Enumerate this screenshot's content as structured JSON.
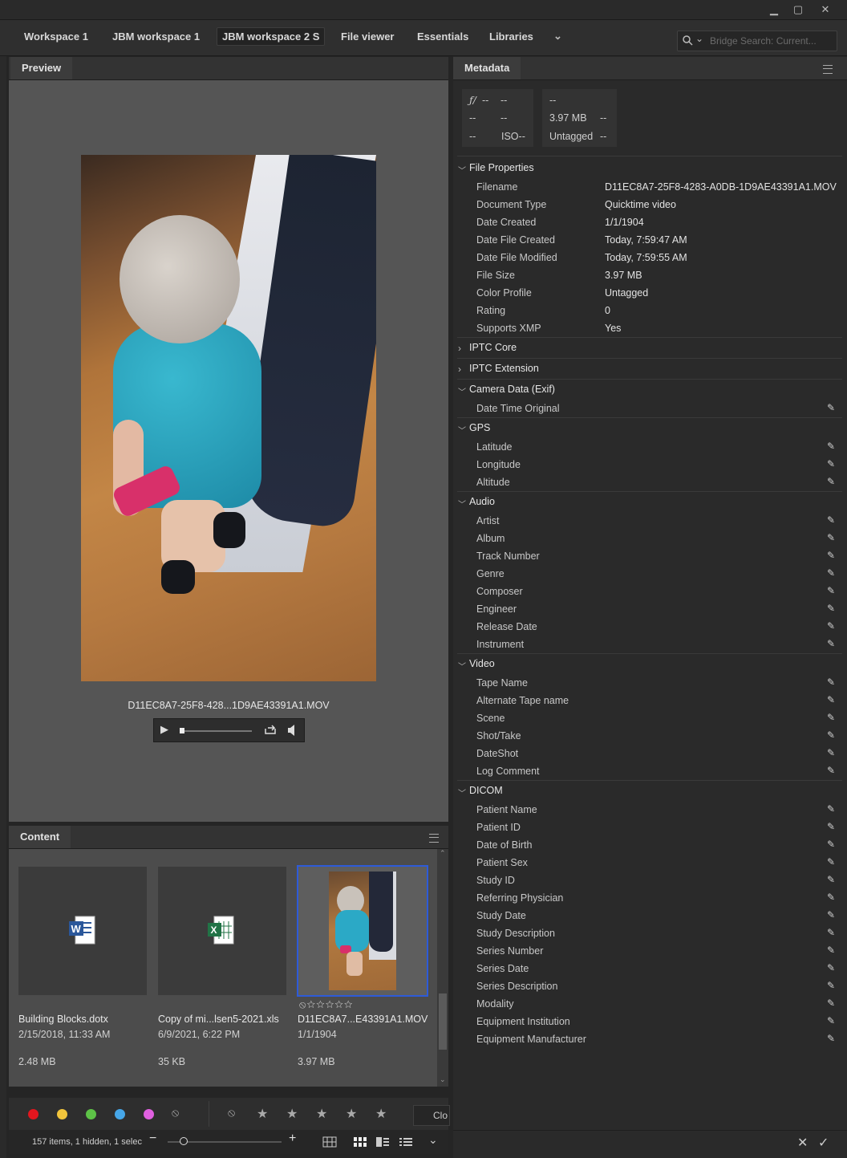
{
  "workspace": {
    "tabs": [
      "Workspace 1",
      "JBM workspace 1",
      "JBM workspace 2 S",
      "File viewer",
      "Essentials",
      "Libraries"
    ],
    "search_placeholder": "Bridge Search: Current..."
  },
  "preview": {
    "panel_title": "Preview",
    "filename": "D11EC8A7-25F8-428...1D9AE43391A1.MOV"
  },
  "content": {
    "panel_title": "Content",
    "items": [
      {
        "name": "Building Blocks.dotx",
        "date": "2/15/2018, 11:33 AM",
        "size": "2.48 MB",
        "icon": "word-document-icon"
      },
      {
        "name": "Copy of mi...lsen5-2021.xls",
        "date": "6/9/2021, 6:22 PM",
        "size": "35 KB",
        "icon": "excel-spreadsheet-icon"
      },
      {
        "name": "D11EC8A7...E43391A1.MOV",
        "date": "1/1/1904",
        "size": "3.97 MB",
        "icon": "video-thumbnail"
      }
    ],
    "label_colors": [
      "#e3161e",
      "#f2c53c",
      "#5dc247",
      "#46a6e8",
      "#e060e0"
    ],
    "status": "157 items, 1 hidden, 1 selec",
    "close_label": "Clo"
  },
  "metadata": {
    "panel_title": "Metadata",
    "camera_box": {
      "fstop": "--",
      "shutter": "--",
      "r2a": "--",
      "r2b": "--",
      "r3a": "--",
      "iso": "ISO--"
    },
    "file_box": {
      "line1": "--",
      "size": "3.97 MB",
      "size_extra": "--",
      "color": "Untagged",
      "color_extra": "--"
    },
    "file_properties": {
      "title": "File Properties",
      "rows": [
        {
          "label": "Filename",
          "value": "D11EC8A7-25F8-4283-A0DB-1D9AE43391A1.MOV"
        },
        {
          "label": "Document Type",
          "value": "Quicktime video"
        },
        {
          "label": "Date Created",
          "value": "1/1/1904"
        },
        {
          "label": "Date File Created",
          "value": "Today, 7:59:47 AM"
        },
        {
          "label": "Date File Modified",
          "value": "Today, 7:59:55 AM"
        },
        {
          "label": "File Size",
          "value": "3.97 MB"
        },
        {
          "label": "Color Profile",
          "value": "Untagged"
        },
        {
          "label": "Rating",
          "value": "0"
        },
        {
          "label": "Supports XMP",
          "value": "Yes"
        }
      ]
    },
    "iptc_core": "IPTC Core",
    "iptc_extension": "IPTC Extension",
    "camera": {
      "title": "Camera Data (Exif)",
      "rows": [
        "Date Time Original"
      ]
    },
    "gps": {
      "title": "GPS",
      "rows": [
        "Latitude",
        "Longitude",
        "Altitude"
      ]
    },
    "audio": {
      "title": "Audio",
      "rows": [
        "Artist",
        "Album",
        "Track Number",
        "Genre",
        "Composer",
        "Engineer",
        "Release Date",
        "Instrument"
      ]
    },
    "video": {
      "title": "Video",
      "rows": [
        "Tape Name",
        "Alternate Tape name",
        "Scene",
        "Shot/Take",
        "DateShot",
        "Log Comment"
      ]
    },
    "dicom": {
      "title": "DICOM",
      "rows": [
        "Patient Name",
        "Patient ID",
        "Date of Birth",
        "Patient Sex",
        "Study ID",
        "Referring Physician",
        "Study Date",
        "Study Description",
        "Series Number",
        "Series Date",
        "Series Description",
        "Modality",
        "Equipment Institution",
        "Equipment Manufacturer"
      ]
    }
  }
}
